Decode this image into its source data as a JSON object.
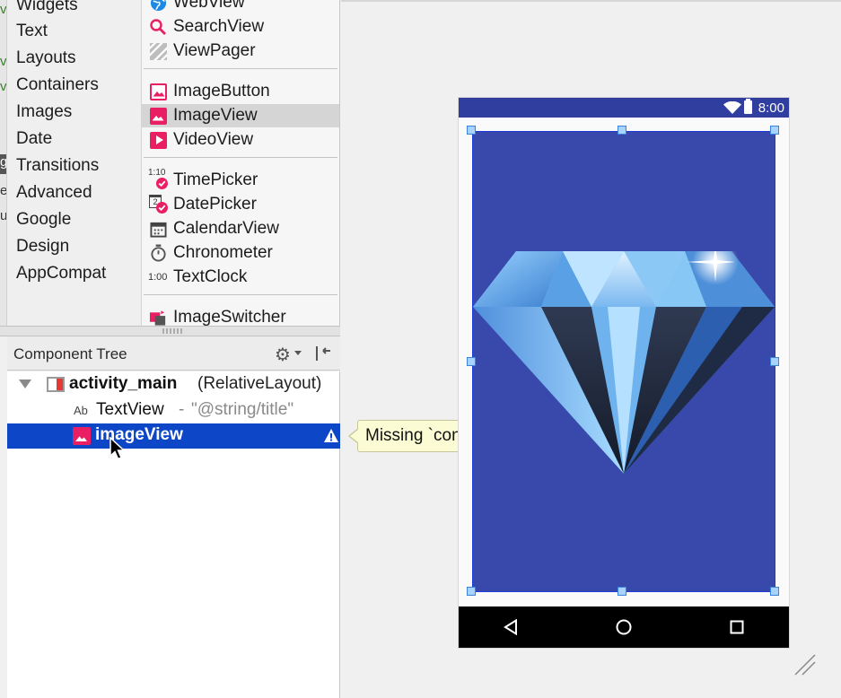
{
  "palette": {
    "categories": [
      "Widgets",
      "Text",
      "Layouts",
      "Containers",
      "Images",
      "Date",
      "Transitions",
      "Advanced",
      "Google",
      "Design",
      "AppCompat"
    ],
    "widgets": [
      {
        "label": "WebView",
        "icon": "globe-icon"
      },
      {
        "label": "SearchView",
        "icon": "search-icon"
      },
      {
        "label": "ViewPager",
        "icon": "stripes-icon"
      },
      {
        "label": "ImageButton",
        "icon": "image-button-icon"
      },
      {
        "label": "ImageView",
        "icon": "image-icon",
        "selected": true
      },
      {
        "label": "VideoView",
        "icon": "play-icon"
      },
      {
        "label": "TimePicker",
        "icon": "time-picker-icon",
        "icon_text": "1:10"
      },
      {
        "label": "DatePicker",
        "icon": "date-picker-icon",
        "icon_text": "2"
      },
      {
        "label": "CalendarView",
        "icon": "calendar-icon"
      },
      {
        "label": "Chronometer",
        "icon": "stopwatch-icon"
      },
      {
        "label": "TextClock",
        "icon": "text-clock-icon",
        "icon_text": "1:00"
      },
      {
        "label": "ImageSwitcher",
        "icon": "image-switcher-icon"
      }
    ]
  },
  "component_tree": {
    "title": "Component Tree",
    "root": {
      "name": "activity_main",
      "type": "(RelativeLayout)"
    },
    "children": [
      {
        "icon_text": "Ab",
        "name": "TextView",
        "separator": "-",
        "value": "\"@string/title\""
      },
      {
        "name": "imageView",
        "selected": true,
        "warning": true
      }
    ]
  },
  "tooltip": {
    "text": "Missing `contentDescription` attribute on image"
  },
  "device": {
    "status_time": "8:00",
    "colors": {
      "status_bar": "#303f9f",
      "image_background": "#3949ab",
      "selection_row": "#0d47c8",
      "accent_pink": "#e91e63"
    }
  }
}
